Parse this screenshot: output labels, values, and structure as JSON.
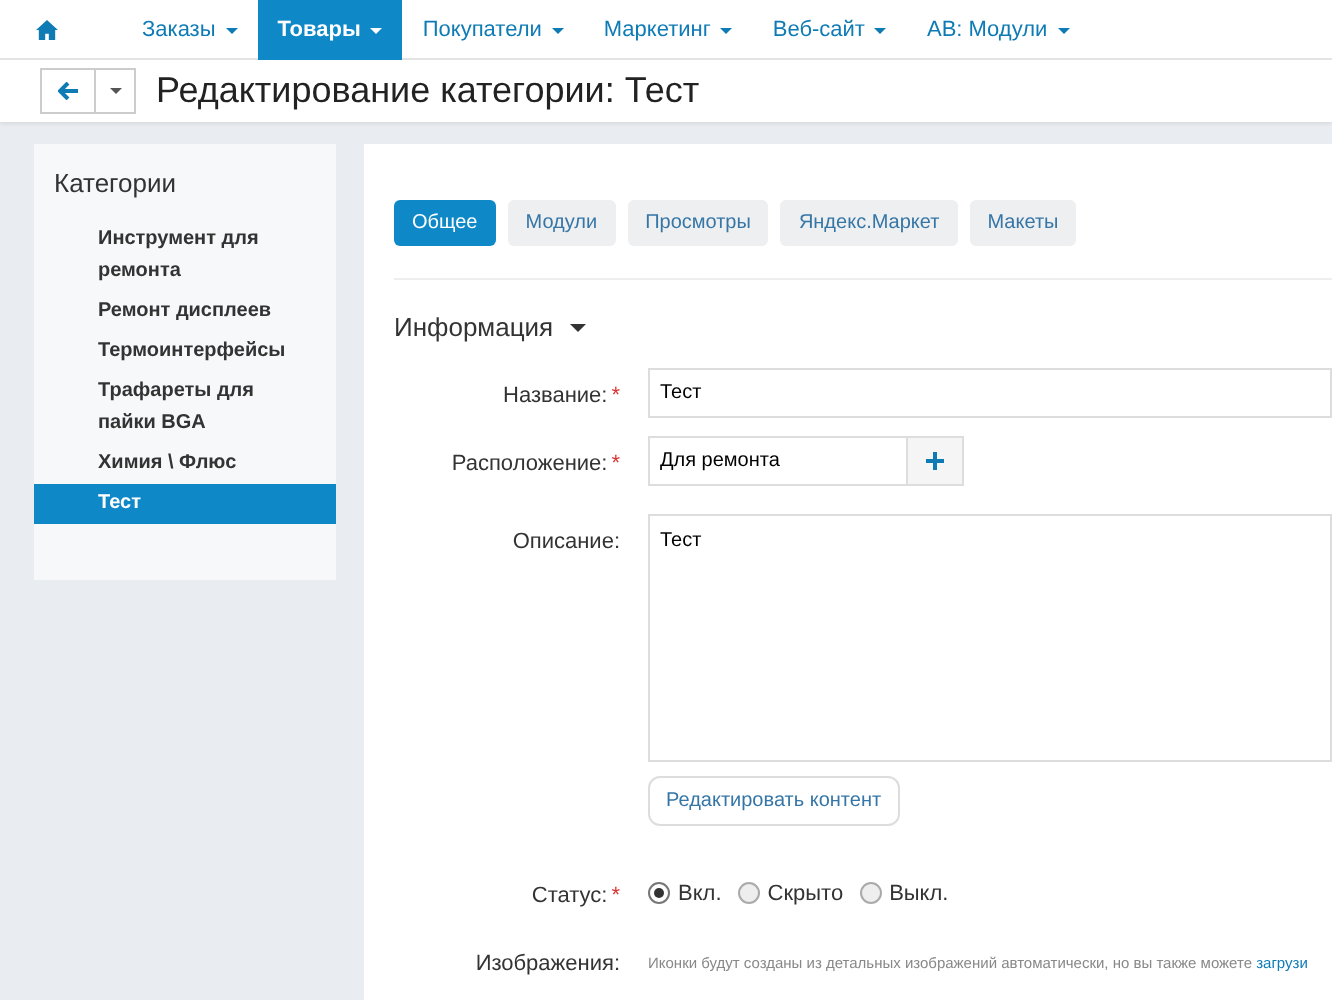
{
  "top_nav": [
    {
      "label": "Заказы",
      "selected": false
    },
    {
      "label": "Товары",
      "selected": true
    },
    {
      "label": "Покупатели",
      "selected": false
    },
    {
      "label": "Маркетинг",
      "selected": false
    },
    {
      "label": "Веб-сайт",
      "selected": false
    },
    {
      "label": "АВ: Модули",
      "selected": false
    }
  ],
  "page_title": "Редактирование категории: Тест",
  "sidebar": {
    "title": "Категории",
    "items": [
      {
        "label": "Инструмент для ремонта",
        "selected": false
      },
      {
        "label": "Ремонт дисплеев",
        "selected": false
      },
      {
        "label": "Термоинтерфейсы",
        "selected": false
      },
      {
        "label": "Трафареты для пайки BGA",
        "selected": false
      },
      {
        "label": "Химия \\ Флюс",
        "selected": false
      },
      {
        "label": "Тест",
        "selected": true
      }
    ]
  },
  "tabs": [
    {
      "label": "Общее",
      "selected": true
    },
    {
      "label": "Модули",
      "selected": false
    },
    {
      "label": "Просмотры",
      "selected": false
    },
    {
      "label": "Яндекс.Маркет",
      "selected": false
    },
    {
      "label": "Макеты",
      "selected": false
    }
  ],
  "section_title": "Информация",
  "fields": [
    {
      "kind": "text",
      "label": "Название:",
      "required_mark": "*",
      "value": "Тест"
    },
    {
      "kind": "picker",
      "label": "Расположение:",
      "required_mark": "*",
      "value": "Для ремонта"
    },
    {
      "kind": "textarea",
      "label": "Описание:",
      "value": "Тест",
      "button": "Редактировать контент"
    },
    {
      "kind": "radio",
      "label": "Статус:",
      "required_mark": "*",
      "options": [
        {
          "label": "Вкл.",
          "selected": true
        },
        {
          "label": "Скрыто",
          "selected": false
        },
        {
          "label": "Выкл.",
          "selected": false
        }
      ]
    },
    {
      "kind": "note",
      "label": "Изображения:",
      "text": "Иконки будут созданы из детальных изображений автоматически, но вы также можете ",
      "link": "загрузи"
    }
  ]
}
